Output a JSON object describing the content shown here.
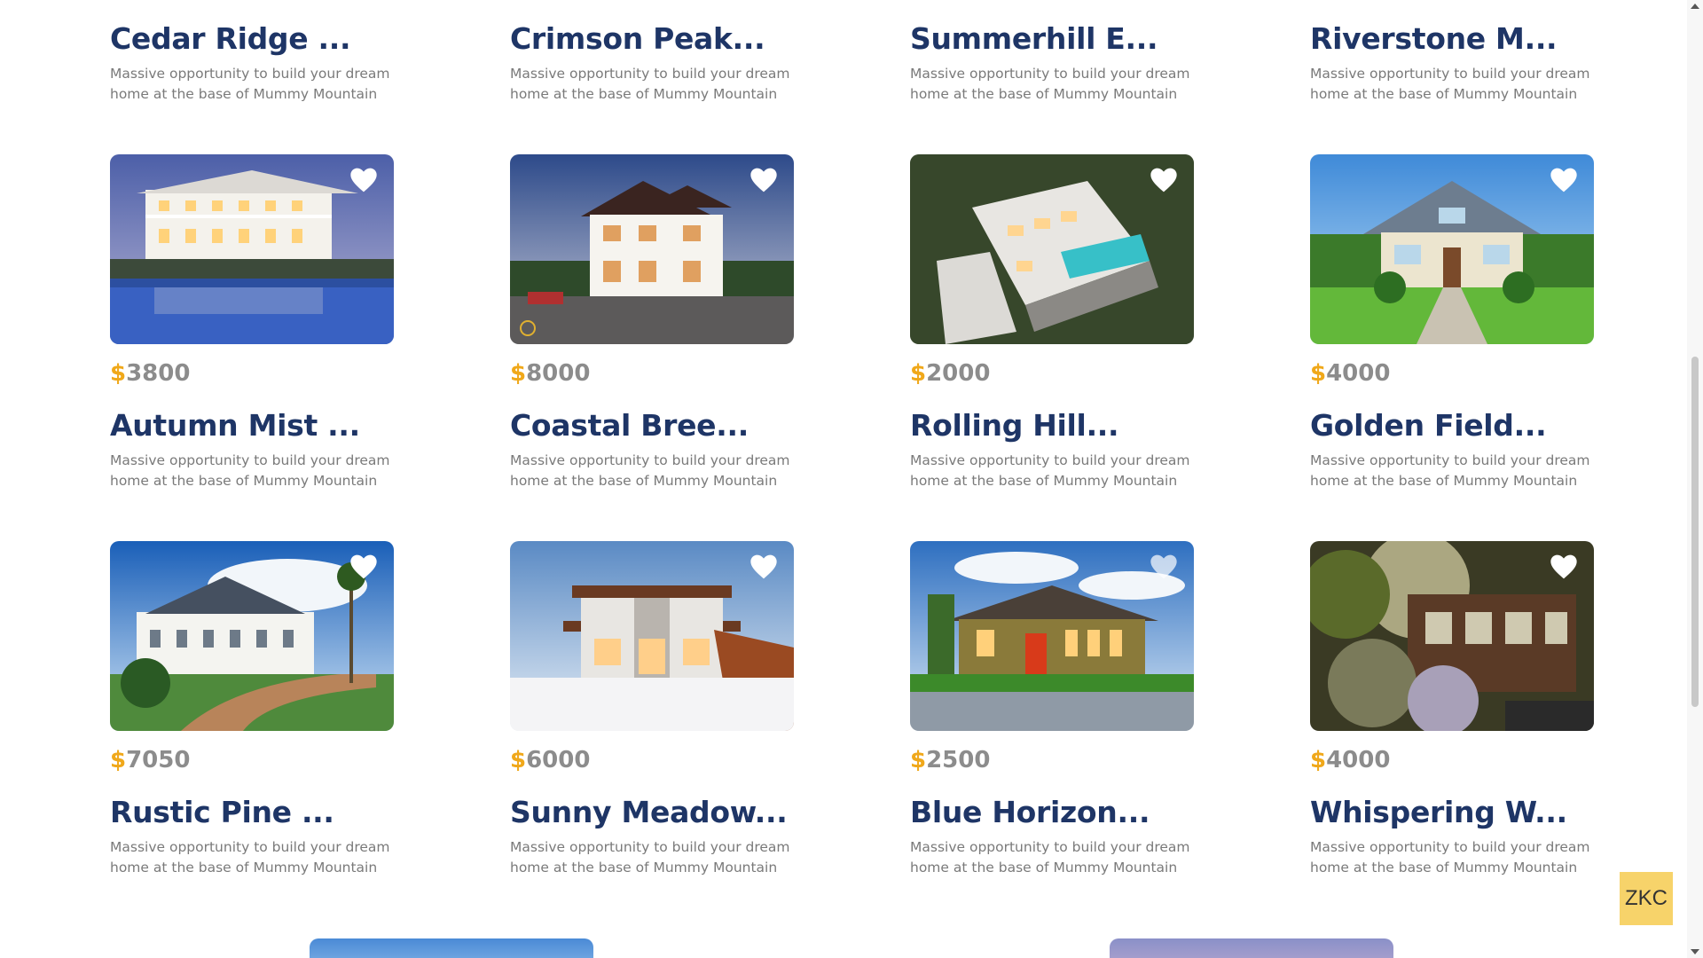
{
  "description_text": "Massive opportunity to build your dream home at the base of Mummy Mountain in...",
  "currency": "$",
  "colors": {
    "title": "#1e3566",
    "price": "#8c8c8c",
    "currency": "#f0a81a",
    "description": "#7a7a7a"
  },
  "top_row": [
    {
      "title": "Cedar Ridge ...",
      "description": "Massive opportunity to build your dream home at the base of Mummy Mountain in..."
    },
    {
      "title": "Crimson Peak...",
      "description": "Massive opportunity to build your dream home at the base of Mummy Mountain in..."
    },
    {
      "title": "Summerhill E...",
      "description": "Massive opportunity to build your dream home at the base of Mummy Mountain in..."
    },
    {
      "title": "Riverstone M...",
      "description": "Massive opportunity to build your dream home at the base of Mummy Mountain in..."
    }
  ],
  "middle_row": [
    {
      "price": "3800",
      "title": "Autumn Mist ...",
      "description": "Massive opportunity to build your dream home at the base of Mummy Mountain in...",
      "image": "lakeside-mansion-icon"
    },
    {
      "price": "8000",
      "title": "Coastal Bree...",
      "description": "Massive opportunity to build your dream home at the base of Mummy Mountain in...",
      "image": "modern-villa-icon"
    },
    {
      "price": "2000",
      "title": "Rolling Hill...",
      "description": "Massive opportunity to build your dream home at the base of Mummy Mountain in...",
      "image": "cliffside-house-icon"
    },
    {
      "price": "4000",
      "title": "Golden Field...",
      "description": "Massive opportunity to build your dream home at the base of Mummy Mountain in...",
      "image": "suburban-house-icon"
    }
  ],
  "bottom_row": [
    {
      "price": "7050",
      "title": "Rustic Pine ...",
      "description": "Massive opportunity to build your dream home at the base of Mummy Mountain in...",
      "image": "victorian-mansion-icon"
    },
    {
      "price": "6000",
      "title": "Sunny Meadow...",
      "description": "Massive opportunity to build your dream home at the base of Mummy Mountain in...",
      "image": "snow-modern-house-icon"
    },
    {
      "price": "2500",
      "title": "Blue Horizon...",
      "description": "Massive opportunity to build your dream home at the base of Mummy Mountain in...",
      "image": "craftsman-house-icon"
    },
    {
      "price": "4000",
      "title": "Whispering W...",
      "description": "Massive opportunity to build your dream home at the base of Mummy Mountain in...",
      "image": "garden-house-icon"
    }
  ],
  "badge": "ZKC"
}
